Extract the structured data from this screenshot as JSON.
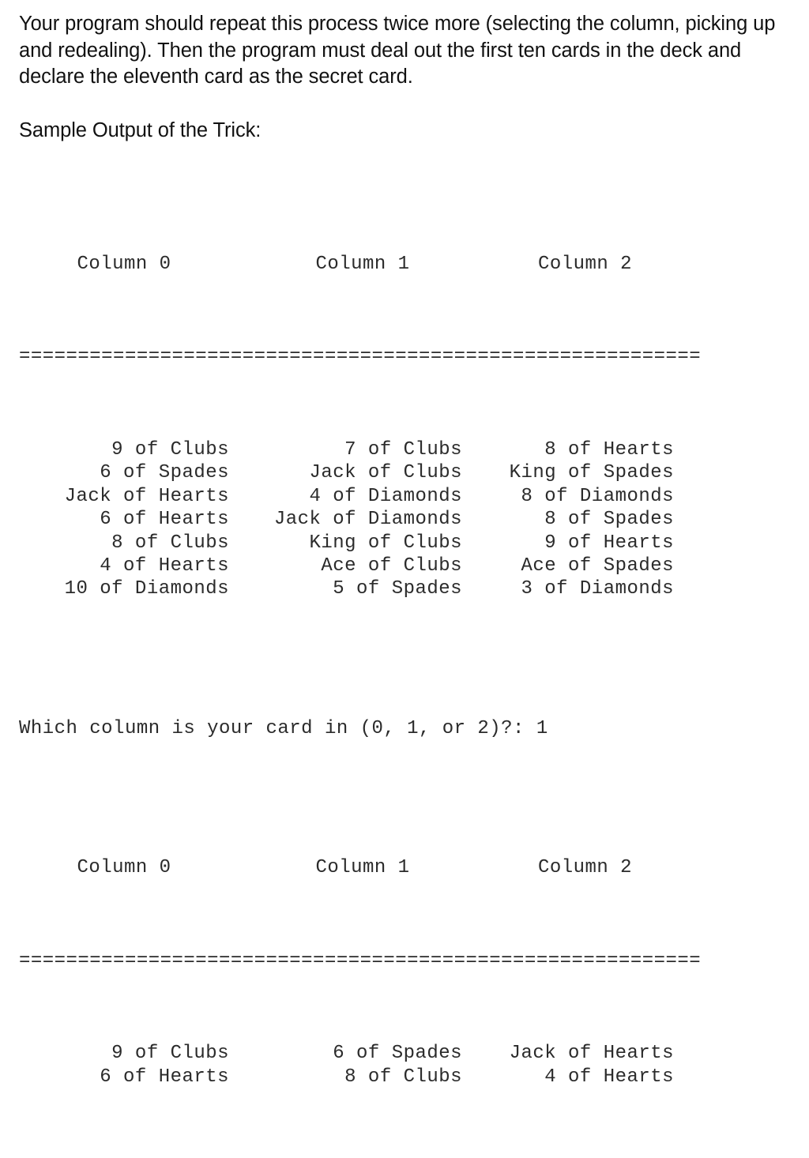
{
  "document": {
    "intro_paragraph": "Your program should repeat this process twice more (selecting the column, picking up and redealing).  Then the program must deal out the first ten cards in the deck and declare the eleventh card as the secret card.",
    "section_heading": "Sample Output of the Trick:"
  },
  "console": {
    "separator": "==========================================================",
    "prompt_line": "Which column is your card in (0, 1, or 2)?: 1",
    "deal_one": {
      "headers": [
        "Column 0",
        "Column 1",
        "Column 2"
      ],
      "rows": [
        [
          "9 of Clubs",
          "7 of Clubs",
          "8 of Hearts"
        ],
        [
          "6 of Spades",
          "Jack of Clubs",
          "King of Spades"
        ],
        [
          "Jack of Hearts",
          "4 of Diamonds",
          "8 of Diamonds"
        ],
        [
          "6 of Hearts",
          "Jack of Diamonds",
          "8 of Spades"
        ],
        [
          "8 of Clubs",
          "King of Clubs",
          "9 of Hearts"
        ],
        [
          "4 of Hearts",
          "Ace of Clubs",
          "Ace of Spades"
        ],
        [
          "10 of Diamonds",
          "5 of Spades",
          "3 of Diamonds"
        ]
      ]
    },
    "deal_two": {
      "headers": [
        "Column 0",
        "Column 1",
        "Column 2"
      ],
      "rows": [
        [
          "9 of Clubs",
          "6 of Spades",
          "Jack of Hearts"
        ],
        [
          "6 of Hearts",
          "8 of Clubs",
          "4 of Hearts"
        ]
      ]
    }
  }
}
